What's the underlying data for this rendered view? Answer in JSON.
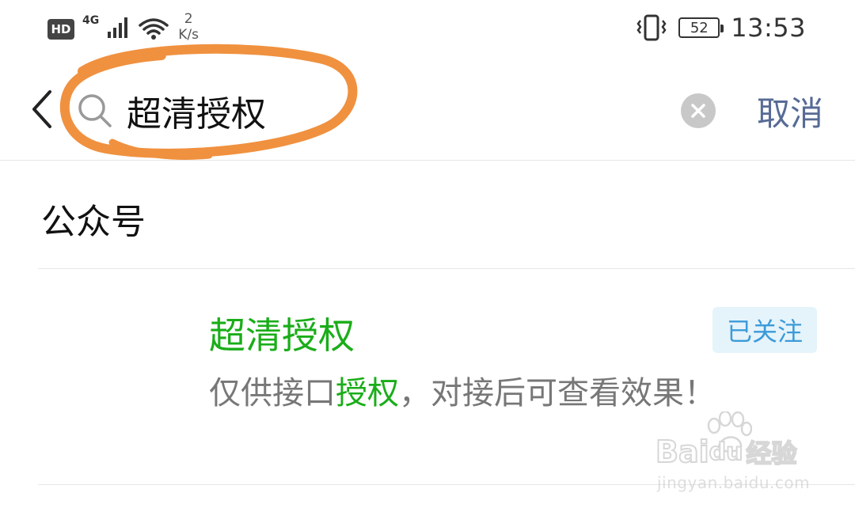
{
  "status_bar": {
    "hd_label": "HD",
    "network_type": "4G",
    "speed_value": "2",
    "speed_unit": "K/s",
    "battery_level": "52",
    "time": "13:53"
  },
  "search": {
    "query": "超清授权",
    "cancel_label": "取消"
  },
  "section": {
    "title": "公众号"
  },
  "result": {
    "name": "超清授权",
    "follow_badge": "已关注",
    "desc_before": "仅供接口",
    "desc_highlight": "授权",
    "desc_after": "，对接后可查看效果！"
  },
  "watermark": {
    "logo_text": "Bai",
    "logo_text_2": "du",
    "logo_suffix": "经验",
    "url": "jingyan.baidu.com"
  },
  "colors": {
    "highlight_green": "#1aad19",
    "cancel_blue": "#576b95",
    "badge_bg": "#e5f3fb",
    "badge_text": "#3b9bd8",
    "annotation_orange": "#f0913f"
  }
}
